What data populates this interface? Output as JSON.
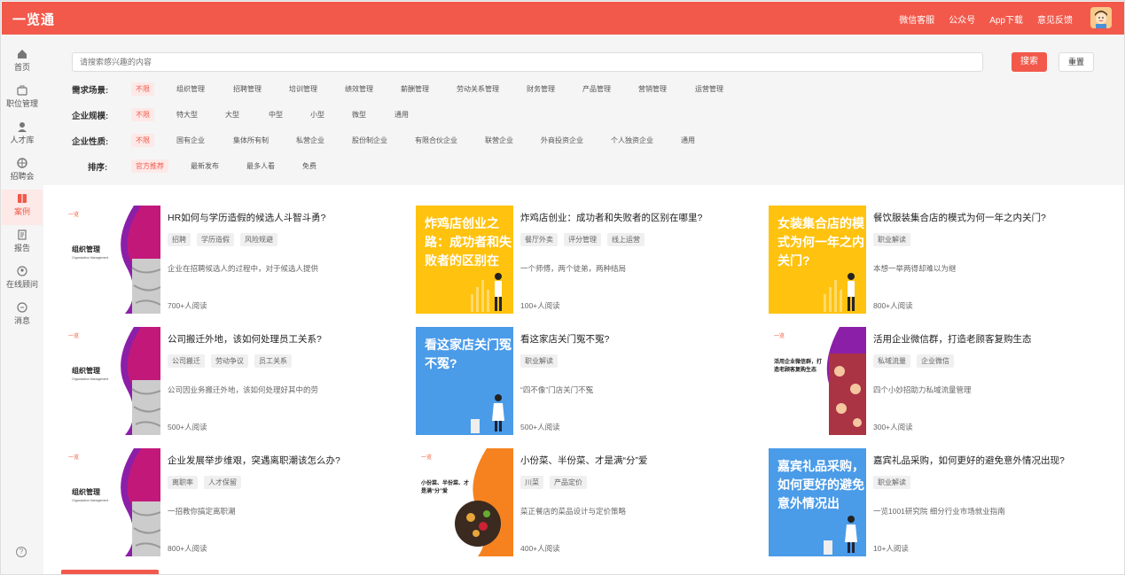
{
  "app": {
    "brand": "一览通"
  },
  "topnav": [
    "微信客服",
    "公众号",
    "App下载",
    "意见反馈"
  ],
  "sidebar": [
    {
      "label": "首页",
      "icon": "home-icon"
    },
    {
      "label": "职位管理",
      "icon": "briefcase-icon"
    },
    {
      "label": "人才库",
      "icon": "person-icon"
    },
    {
      "label": "招聘会",
      "icon": "fair-icon"
    },
    {
      "label": "案例",
      "icon": "book-icon",
      "active": true
    },
    {
      "label": "报告",
      "icon": "report-icon"
    },
    {
      "label": "在线顾问",
      "icon": "advisor-icon"
    },
    {
      "label": "消息",
      "icon": "message-icon"
    }
  ],
  "search": {
    "placeholder": "请搜索感兴趣的内容",
    "search_label": "搜索",
    "reset_label": "重置"
  },
  "filters": {
    "scene": {
      "label": "需求场景:",
      "options": [
        "不限",
        "组织管理",
        "招聘管理",
        "培训管理",
        "绩效管理",
        "薪酬管理",
        "劳动关系管理",
        "财务管理",
        "产品管理",
        "营销管理",
        "运营管理"
      ]
    },
    "scale": {
      "label": "企业规模:",
      "options": [
        "不限",
        "特大型",
        "大型",
        "中型",
        "小型",
        "微型",
        "通用"
      ]
    },
    "nature": {
      "label": "企业性质:",
      "options": [
        "不限",
        "国有企业",
        "集体所有制",
        "私营企业",
        "股份制企业",
        "有限合伙企业",
        "联营企业",
        "外商投资企业",
        "个人独资企业",
        "通用"
      ]
    },
    "sort": {
      "label": "排序:",
      "options": [
        "官方推荐",
        "最新发布",
        "最多人看",
        "免费"
      ]
    }
  },
  "cards": [
    {
      "title": "HR如何与学历造假的候选人斗智斗勇?",
      "tags": [
        "招聘",
        "学历造假",
        "风险规避"
      ],
      "desc": "企业在招聘候选人的过程中，对于候选人提供",
      "reads": "700+人阅读",
      "thumb": "org"
    },
    {
      "title": "炸鸡店创业：成功者和失败者的区别在哪里?",
      "tags": [
        "餐厅外卖",
        "评分管理",
        "线上运营"
      ],
      "desc": "一个师傅，两个徒弟，两种结局",
      "reads": "100+人阅读",
      "thumb": "yellow",
      "thumb_text": "炸鸡店创业之路：成功者和失败者的区别在"
    },
    {
      "title": "餐饮服装集合店的模式为何一年之内关门?",
      "tags": [
        "职业解读"
      ],
      "desc": "本想一举两得却难以为继",
      "reads": "800+人阅读",
      "thumb": "yellow",
      "thumb_text": "女装集合店的模式为何一年之内关门?"
    },
    {
      "title": "公司搬迁外地，该如何处理员工关系?",
      "tags": [
        "公司搬迁",
        "劳动争议",
        "员工关系"
      ],
      "desc": "公司因业务搬迁外地，该如何处理好其中的劳",
      "reads": "500+人阅读",
      "thumb": "org"
    },
    {
      "title": "看这家店关门冤不冤?",
      "tags": [
        "职业解读"
      ],
      "desc": "“四不像”门店关门不冤",
      "reads": "500+人阅读",
      "thumb": "blue",
      "thumb_text": "看这家店关门冤不冤?"
    },
    {
      "title": "活用企业微信群，打造老顾客复购生态",
      "tags": [
        "私域流量",
        "企业微信"
      ],
      "desc": "四个小妙招助力私域流量管理",
      "reads": "300+人阅读",
      "thumb": "wechat"
    },
    {
      "title": "企业发展举步维艰，突遇离职潮该怎么办?",
      "tags": [
        "离职率",
        "人才保留"
      ],
      "desc": "一招教你搞定离职潮",
      "reads": "800+人阅读",
      "thumb": "org"
    },
    {
      "title": "小份菜、半份菜、才是满“分”爱",
      "tags": [
        "川菜",
        "产品定价"
      ],
      "desc": "菜正餐店的菜品设计与定价策略",
      "reads": "400+人阅读",
      "thumb": "food"
    },
    {
      "title": "嘉宾礼品采购，如何更好的避免意外情况出现?",
      "tags": [
        "职业解读"
      ],
      "desc": "一览1001研究院 细分行业市场就业指南",
      "reads": "10+人阅读",
      "thumb": "blue",
      "thumb_text": "嘉宾礼品采购，如何更好的避免意外情况出"
    }
  ],
  "thumb_labels": {
    "org_cn": "组织管理",
    "org_en": "Organization Management",
    "logo": "一览",
    "wechat_text": "活用企业微信群，打造老顾客复购生态",
    "food_text": "小份菜、半份菜、才是满“分”爱"
  },
  "colors": {
    "accent": "#f2594b",
    "yellow": "#ffc20e",
    "blue": "#4a9be8"
  }
}
